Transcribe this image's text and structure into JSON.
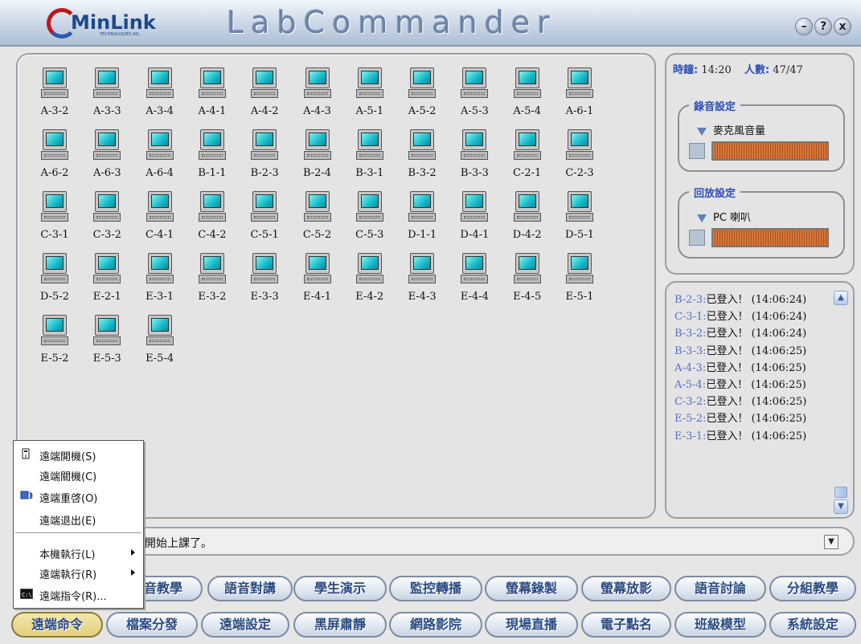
{
  "app": {
    "brand": "MinLink",
    "brand_sub": "TECHNOLOGIES INC.",
    "title": "LabCommander",
    "window_buttons": [
      {
        "name": "minimize",
        "glyph": "–"
      },
      {
        "name": "help",
        "glyph": "?"
      },
      {
        "name": "close",
        "glyph": "x"
      }
    ]
  },
  "clients": [
    "A-3-2",
    "A-3-3",
    "A-3-4",
    "A-4-1",
    "A-4-2",
    "A-4-3",
    "A-5-1",
    "A-5-2",
    "A-5-3",
    "A-5-4",
    "A-6-1",
    "A-6-2",
    "A-6-3",
    "A-6-4",
    "B-1-1",
    "B-2-3",
    "B-2-4",
    "B-3-1",
    "B-3-2",
    "B-3-3",
    "C-2-1",
    "C-2-3",
    "C-3-1",
    "C-3-2",
    "C-4-1",
    "C-4-2",
    "C-5-1",
    "C-5-2",
    "C-5-3",
    "D-1-1",
    "D-4-1",
    "D-4-2",
    "D-5-1",
    "D-5-2",
    "E-2-1",
    "E-3-1",
    "E-3-2",
    "E-3-3",
    "E-4-1",
    "E-4-2",
    "E-4-3",
    "E-4-4",
    "E-4-5",
    "E-5-1",
    "E-5-2",
    "E-5-3",
    "E-5-4"
  ],
  "info": {
    "time_label": "時鐘:",
    "time_value": "14:20",
    "count_label": "人數:",
    "count_value": "47/47"
  },
  "record": {
    "title": "錄音設定",
    "source": "麥克風音量"
  },
  "playback": {
    "title": "回放設定",
    "source": "PC 喇叭"
  },
  "log": [
    {
      "host": "B-2-3:",
      "text": "已登入！",
      "time": "(14:06:24)"
    },
    {
      "host": "C-3-1:",
      "text": "已登入！",
      "time": "(14:06:24)"
    },
    {
      "host": "B-3-2:",
      "text": "已登入！",
      "time": "(14:06:24)"
    },
    {
      "host": "B-3-3:",
      "text": "已登入！",
      "time": "(14:06:25)"
    },
    {
      "host": "A-4-3:",
      "text": "已登入！",
      "time": "(14:06:25)"
    },
    {
      "host": "A-5-4:",
      "text": "已登入！",
      "time": "(14:06:25)"
    },
    {
      "host": "C-3-2:",
      "text": "已登入！",
      "time": "(14:06:25)"
    },
    {
      "host": "E-5-2:",
      "text": "已登入！",
      "time": "(14:06:25)"
    },
    {
      "host": "E-3-1:",
      "text": "已登入！",
      "time": "(14:06:25)"
    }
  ],
  "message": "開始上課了。",
  "context_menu": {
    "items": [
      {
        "label": "遠端開機(S)",
        "icon": "power-on-icon",
        "submenu": false
      },
      {
        "label": "遠端關機(C)",
        "icon": "",
        "submenu": false
      },
      {
        "label": "遠端重啓(O)",
        "icon": "restart-icon",
        "submenu": false
      },
      {
        "label": "遠端退出(E)",
        "icon": "",
        "submenu": false
      },
      {
        "label": "本機執行(L)",
        "icon": "",
        "submenu": true
      },
      {
        "label": "遠端執行(R)",
        "icon": "",
        "submenu": true
      },
      {
        "label": "遠端指令(R)...",
        "icon": "console-icon",
        "submenu": false
      }
    ]
  },
  "toolbar_row1": [
    "語音教學",
    "語音對講",
    "學生演示",
    "監控轉播",
    "螢幕錄製",
    "螢幕放影",
    "語音討論",
    "分組教學"
  ],
  "toolbar_row2": [
    "遠端命令",
    "檔案分發",
    "遠端設定",
    "黑屏肅靜",
    "網路影院",
    "現場直播",
    "電子點名",
    "班級模型",
    "系統設定"
  ],
  "colors": {
    "accent": "#2e4fb4",
    "log_host": "#5470c6",
    "active_button": "#e3ce7c",
    "screen": "#16b8c8"
  }
}
